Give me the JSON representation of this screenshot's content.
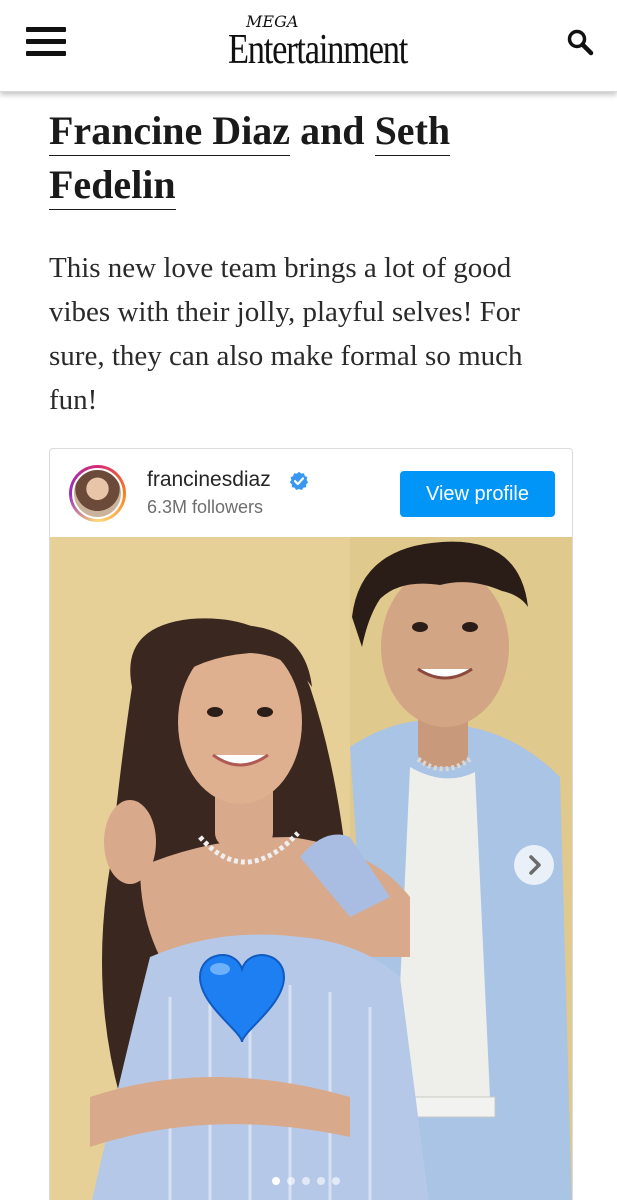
{
  "header": {
    "menu_icon": "hamburger-menu-icon",
    "logo_top": "MEGA",
    "logo_main": "Entertainment",
    "search_icon": "search-icon"
  },
  "article": {
    "title_name1": "Francine Diaz",
    "title_and": "and",
    "title_name2_line1": "Seth",
    "title_name2_line2": "Fedelin",
    "lead": "This new love team brings a lot of good vibes with their jolly, playful selves! For sure, they can also make formal so much fun!"
  },
  "embed": {
    "username": "francinesdiaz",
    "followers": "6.3M followers",
    "view_profile": "View profile",
    "verified_icon": "verified-badge-icon",
    "next_icon": "chevron-right-icon",
    "carousel_count": 5,
    "carousel_active": 1,
    "accent_color": "#0095f6"
  }
}
